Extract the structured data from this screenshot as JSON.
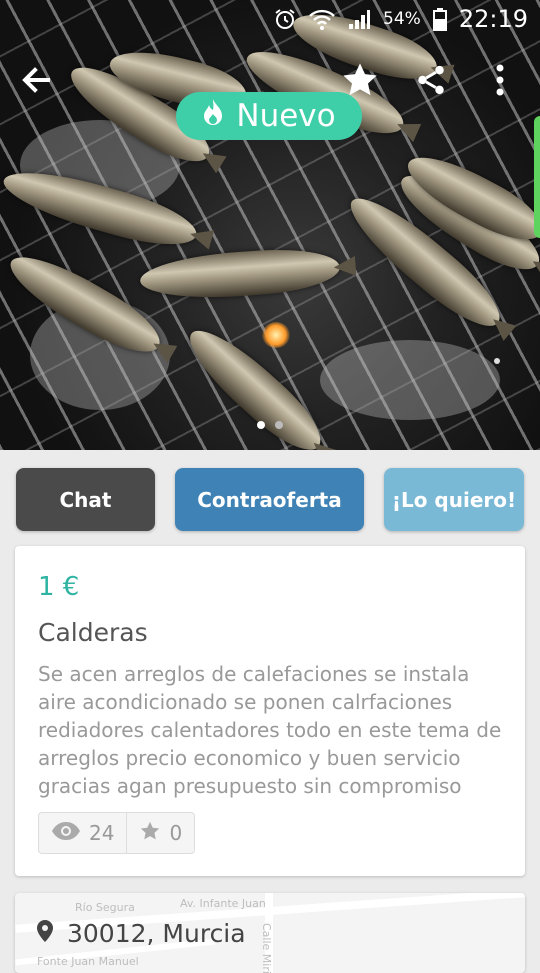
{
  "status_bar": {
    "battery_pct": "54%",
    "time": "22:19",
    "icons": [
      "alarm-icon",
      "wifi-icon",
      "signal-icon",
      "battery-icon"
    ]
  },
  "header": {
    "back_icon": "arrow-left-icon",
    "favorite_icon": "star-icon",
    "share_icon": "share-icon",
    "menu_icon": "more-vert-icon"
  },
  "badge": {
    "icon": "flame-icon",
    "label": "Nuevo",
    "color": "#3ecfa9"
  },
  "actions": {
    "chat": "Chat",
    "counter_offer": "Contraoferta",
    "want": "¡Lo quiero!"
  },
  "product": {
    "price": "1 €",
    "title": "Calderas",
    "description": "Se acen arreglos de calefaciones se instala aire acondicionado se ponen calrfaciones rediadores calentadores todo en este tema de arreglos precio economico y buen servicio gracias agan presupuesto sin compromiso",
    "views": "24",
    "favorites": "0"
  },
  "location": {
    "text": "30012, Murcia",
    "map_labels": [
      "Río Segura",
      "Av. Infante Juan",
      "Calle Mirio",
      "Fonte Juan Manuel"
    ]
  },
  "colors": {
    "accent": "#2fb4a4",
    "chat_button": "#4a4a4a",
    "counter_button": "#3f82b5",
    "want_button": "#79b9d6"
  }
}
